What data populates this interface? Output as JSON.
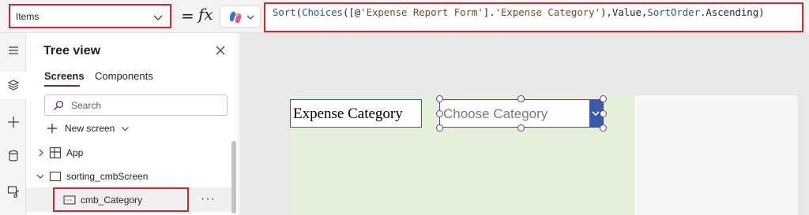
{
  "formula_bar": {
    "property": "Items",
    "equals": "=",
    "fx": "fx",
    "formula_parts": [
      {
        "text": "Sort",
        "kind": "fn"
      },
      {
        "text": "(",
        "kind": "plain"
      },
      {
        "text": "Choices",
        "kind": "fn"
      },
      {
        "text": "([@",
        "kind": "plain"
      },
      {
        "text": "'Expense Report Form'",
        "kind": "str"
      },
      {
        "text": "].",
        "kind": "plain"
      },
      {
        "text": "'Expense Category'",
        "kind": "str"
      },
      {
        "text": "),",
        "kind": "plain"
      },
      {
        "text": "Value",
        "kind": "plain"
      },
      {
        "text": ",",
        "kind": "plain"
      },
      {
        "text": "SortOrder",
        "kind": "fn"
      },
      {
        "text": ".Ascending)",
        "kind": "plain"
      }
    ]
  },
  "tree_view": {
    "title": "Tree view",
    "tabs": {
      "screens": "Screens",
      "components": "Components"
    },
    "search_placeholder": "Search",
    "new_screen": "New screen",
    "items": {
      "app": "App",
      "screen": "sorting_cmbScreen",
      "control": "cmb_Category",
      "more": "···"
    }
  },
  "canvas": {
    "label_text": "Expense Category",
    "combo_placeholder": "Choose Category"
  },
  "colors": {
    "accent": "#742774",
    "highlight_border": "#d9232d",
    "control_blue": "#3a59a8",
    "screen_fill": "#e4f0da"
  }
}
